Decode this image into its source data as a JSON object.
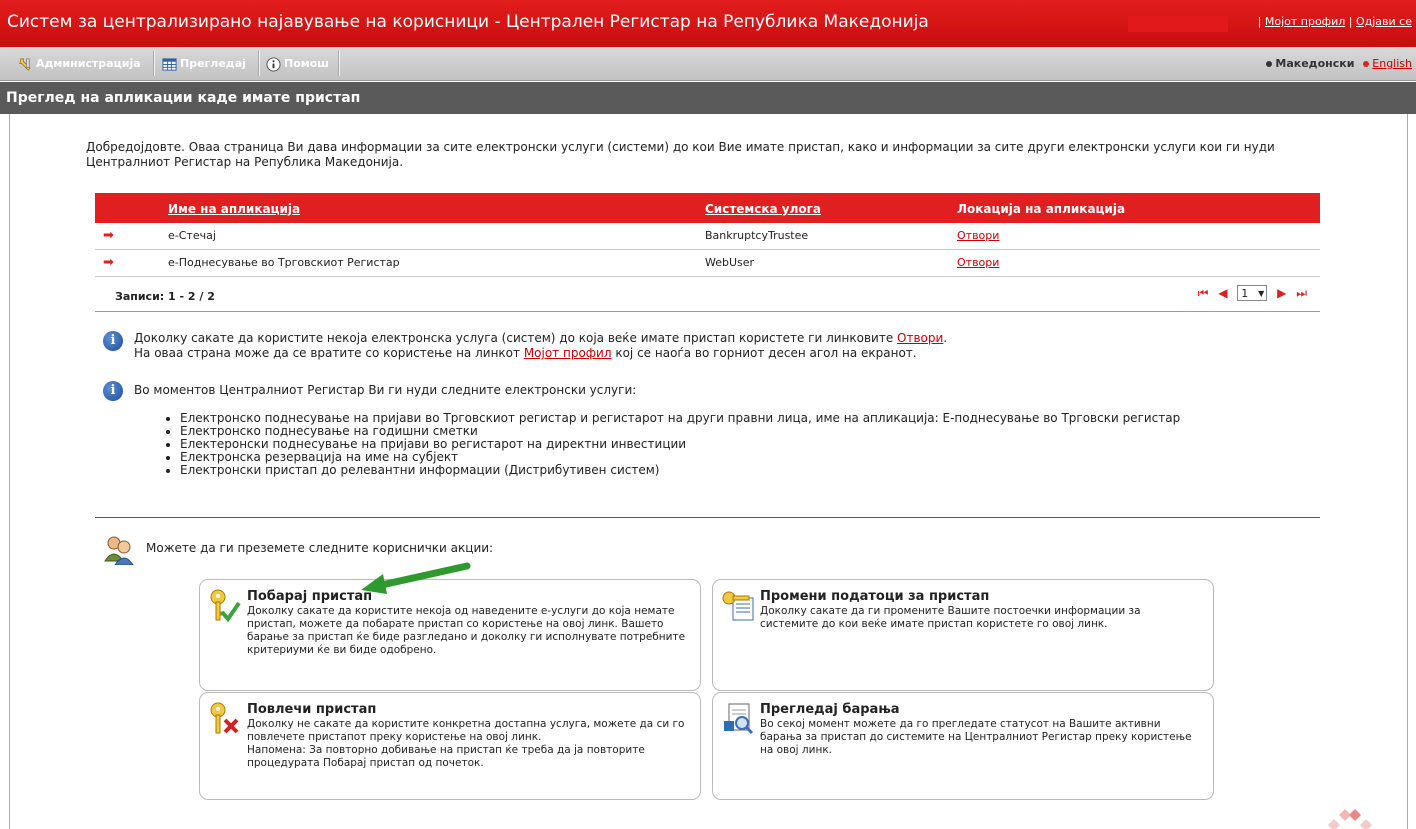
{
  "header": {
    "title": "Систем за централизирано најавување на корисници - Централен Регистар на Република Македонија",
    "sep1": "|",
    "profile_link": "Мојот профил",
    "sep2": "|",
    "logout_link": "Одјави се"
  },
  "menu": {
    "items": [
      {
        "label": "Администрација",
        "icon": "admin-tools-icon"
      },
      {
        "label": "Прегледај",
        "icon": "table-grid-icon"
      },
      {
        "label": "Помош",
        "icon": "info-help-icon"
      }
    ],
    "languages": {
      "current": "Македонски",
      "other": "English"
    }
  },
  "page": {
    "heading": "Преглед на апликации каде имате пристап",
    "welcome": "Добредојдовте. Оваа страница Ви дава информации за сите електронски услуги (системи) до кои Вие имате пристап, како и информации за сите други електронски услуги кои ги нуди Централниот Регистар на Република Македонија."
  },
  "table": {
    "headers": {
      "name": "Име на апликација",
      "role": "Системска улога",
      "location": "Локација на апликација"
    },
    "rows": [
      {
        "name": "е-Стечај",
        "role": "BankruptcyTrustee",
        "link": "Отвори"
      },
      {
        "name": "е-Поднесување во Трговскиот Регистар",
        "role": "WebUser",
        "link": "Отвори"
      }
    ],
    "records": "Записи: 1 - 2 / 2",
    "page_value": "1"
  },
  "info1": {
    "line1_pre": "Доколку сакате да користите некоја електронска услуга (систем) до која веќе имате пристап користете ги линковите ",
    "line1_link": "Отвори",
    "line1_post": ".",
    "line2_pre": "На оваа страна може да се вратите со користење на линкот ",
    "line2_link": "Мојот профил",
    "line2_post": " кој се наоѓа во горниот десен агол на екранот."
  },
  "info2": {
    "intro": "Во моментов Централниот Регистар Ви ги нуди следните електронски услуги:",
    "services": [
      "Електронско поднесување на пријави во Трговскиот регистар и регистарот на други правни лица, име на апликација: Е-поднесување во Трговски регистар",
      "Електронско поднесување на годишни сметки",
      "Електеронски поднесување на пријави во регистарот на директни инвестиции",
      "Електронска резервација на име на субјект",
      "Електронски пристап до релевантни информации (Дистрибутивен систем)"
    ]
  },
  "user_actions": {
    "intro": "Можете да ги преземете следните кориснички акции:",
    "cards": [
      {
        "title": "Побарај пристап",
        "desc": "Доколку сакате да користите некоја од наведените е-услуги до која немате пристап, можете да побарате пристап со користење на овој линк. Вашето барање за пристап ќе биде разгледано и доколку ги исполнувате потребните критериуми ќе ви биде одобрено."
      },
      {
        "title": "Промени податоци за пристап",
        "desc": "Доколку сакате да ги промените Вашите постоечки информации за системите до кои веќе имате пристап користете го овој линк."
      },
      {
        "title": "Повлечи пристап",
        "desc": "Доколку не сакате да користите конкретна достапна услуга, можете да си го повлечете пристапот преку користење на овој линк.\nНапомена: За повторно добивање на пристап ќе треба да ја повторите процедурата Побарај пристап од почеток."
      },
      {
        "title": "Прегледај барања",
        "desc": "Во секој момент можете да го прегледате статусот на Вашите активни барања за пристап до системите на Централниот Регистар преку користење на овој линк."
      }
    ]
  },
  "colors": {
    "brand_red": "#e02020",
    "header_gray": "#5a5a5a",
    "arrow_green": "#2e9a2e"
  }
}
